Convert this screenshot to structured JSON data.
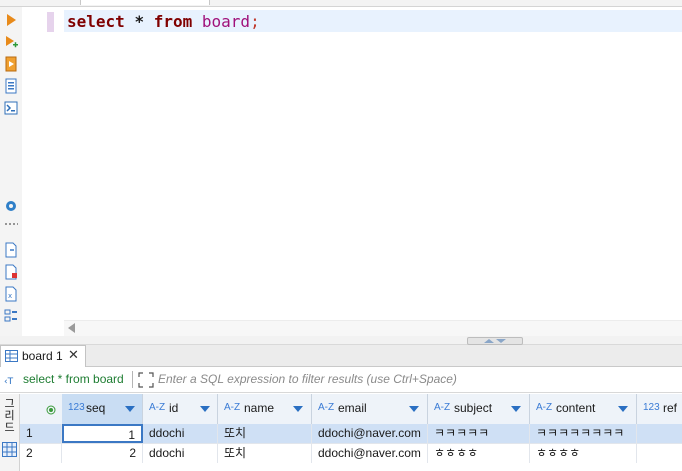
{
  "editor": {
    "keyword_select": "select",
    "star": "*",
    "keyword_from": "from",
    "table_name": "board",
    "terminator": ";"
  },
  "results_tab": {
    "label": "board 1",
    "close": "✕"
  },
  "filter": {
    "query_text": "select * from board",
    "placeholder": "Enter a SQL expression to filter results (use Ctrl+Space)"
  },
  "side_strip": {
    "label": "그리드"
  },
  "grid": {
    "columns": [
      {
        "type": "123",
        "name": "seq"
      },
      {
        "type": "A-Z",
        "name": "id"
      },
      {
        "type": "A-Z",
        "name": "name"
      },
      {
        "type": "A-Z",
        "name": "email"
      },
      {
        "type": "A-Z",
        "name": "subject"
      },
      {
        "type": "A-Z",
        "name": "content"
      },
      {
        "type": "123",
        "name": "ref"
      }
    ],
    "rows": [
      {
        "num": "1",
        "seq": "1",
        "id": "ddochi",
        "name": "또치",
        "email": "ddochi@naver.com",
        "subject": "ㅋㅋㅋㅋㅋ",
        "content": "ㅋㅋㅋㅋㅋㅋㅋㅋ",
        "ref": ""
      },
      {
        "num": "2",
        "seq": "2",
        "id": "ddochi",
        "name": "또치",
        "email": "ddochi@naver.com",
        "subject": "ㅎㅎㅎㅎ",
        "content": "ㅎㅎㅎㅎ",
        "ref": ""
      }
    ]
  },
  "colors": {
    "keyword": "#800000",
    "table": "#a0117a",
    "line_highlight": "#e8f2fe",
    "selected_row": "#cfe0f5",
    "filter_text": "#1e7d32"
  }
}
